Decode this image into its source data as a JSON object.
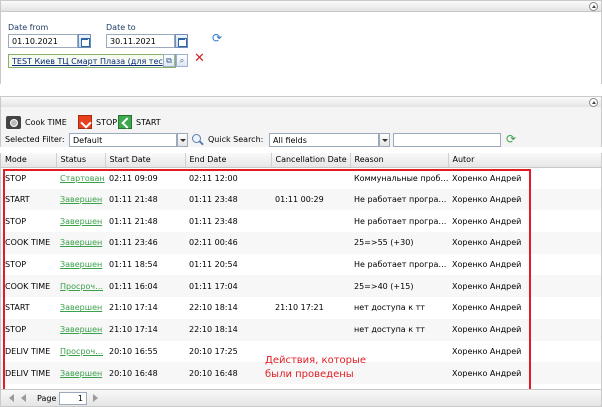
{
  "filter": {
    "date_from_label": "Date from",
    "date_from_value": "01.10.2021",
    "date_to_label": "Date to",
    "date_to_value": "30.11.2021",
    "store_value": "TEST Киев ТЦ Смарт Плаза (для тес"
  },
  "toolbar": {
    "cook_time_label": "Cook TIME",
    "stop_label": "STOP",
    "start_label": "START",
    "selected_filter_label": "Selected Filter:",
    "selected_filter_value": "Default",
    "quick_search_label": "Quick Search:",
    "quick_search_field": "All fields"
  },
  "columns": [
    "Mode",
    "Status",
    "Start Date",
    "End Date",
    "Cancellation Date",
    "Reason",
    "Autor"
  ],
  "rows": [
    [
      "STOP",
      "Стартован",
      "02:11 09:09",
      "02:11 12:00",
      "",
      "Коммунальные проб…",
      "Хоренко Андрей"
    ],
    [
      "START",
      "Завершен",
      "01:11 21:48",
      "01:11 23:48",
      "01:11 00:29",
      "Не работает програ…",
      "Хоренко Андрей"
    ],
    [
      "STOP",
      "Завершен",
      "01:11 21:48",
      "01:11 23:48",
      "",
      "Не работает програ…",
      "Хоренко Андрей"
    ],
    [
      "COOK TIME",
      "Завершен",
      "01:11 23:46",
      "02:11 00:46",
      "",
      "25=>55 (+30)",
      "Хоренко Андрей"
    ],
    [
      "STOP",
      "Завершен",
      "01:11 18:54",
      "01:11 20:54",
      "",
      "Не работает програ…",
      "Хоренко Андрей"
    ],
    [
      "COOK TIME",
      "Просроч…",
      "01:11 16:04",
      "01:11 17:04",
      "",
      "25=>40 (+15)",
      "Хоренко Андрей"
    ],
    [
      "START",
      "Завершен",
      "21:10 17:14",
      "22:10 18:14",
      "21:10 17:21",
      "нет доступа к тт",
      "Хоренко Андрей"
    ],
    [
      "STOP",
      "Завершен",
      "21:10 17:14",
      "22:10 18:14",
      "",
      "нет доступа к тт",
      "Хоренко Андрей"
    ],
    [
      "DELIV TIME",
      "Просроч…",
      "20:10 16:55",
      "20:10 17:25",
      "",
      "",
      "Хоренко Андрей"
    ],
    [
      "DELIV TIME",
      "Завершен",
      "20:10 16:48",
      "20:10 16:48",
      "",
      "",
      "Хоренко Андрей"
    ]
  ],
  "annotation": "Действия, которые были проведены",
  "pager": {
    "page_label": "Page",
    "page_value": "1"
  },
  "colors": {
    "accent_red": "#e11c22",
    "status_green": "#3aa04a"
  }
}
